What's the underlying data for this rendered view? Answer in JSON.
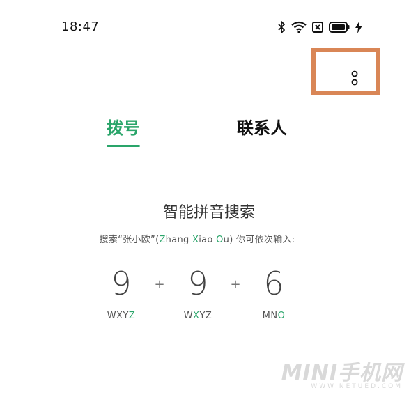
{
  "status": {
    "time": "18:47",
    "icons": [
      "bluetooth-icon",
      "wifi-icon",
      "sim-icon",
      "battery-icon",
      "charging-icon"
    ]
  },
  "tabs": [
    {
      "label": "拨号",
      "active": true
    },
    {
      "label": "联系人",
      "active": false
    }
  ],
  "hint": {
    "title": "智能拼音搜索",
    "sub_prefix": "搜索“张小欧”(",
    "sub_z": "Z",
    "sub_hang": "hang ",
    "sub_x": "X",
    "sub_iao": "iao ",
    "sub_o": "O",
    "sub_u": "u",
    "sub_suffix": ") 你可依次输入:"
  },
  "keys": [
    {
      "digit": "9",
      "letters_pre": "WXY",
      "letters_hl": "Z",
      "letters_post": ""
    },
    {
      "digit": "9",
      "letters_pre": "W",
      "letters_hl": "X",
      "letters_post": "YZ"
    },
    {
      "digit": "6",
      "letters_pre": "MN",
      "letters_hl": "O",
      "letters_post": ""
    }
  ],
  "plus": "+",
  "watermark": {
    "big": "MINI手机网",
    "small": "WWW.NETUED.COM"
  },
  "colors": {
    "accent": "#2aa56a",
    "highlight_box": "#d98656"
  }
}
